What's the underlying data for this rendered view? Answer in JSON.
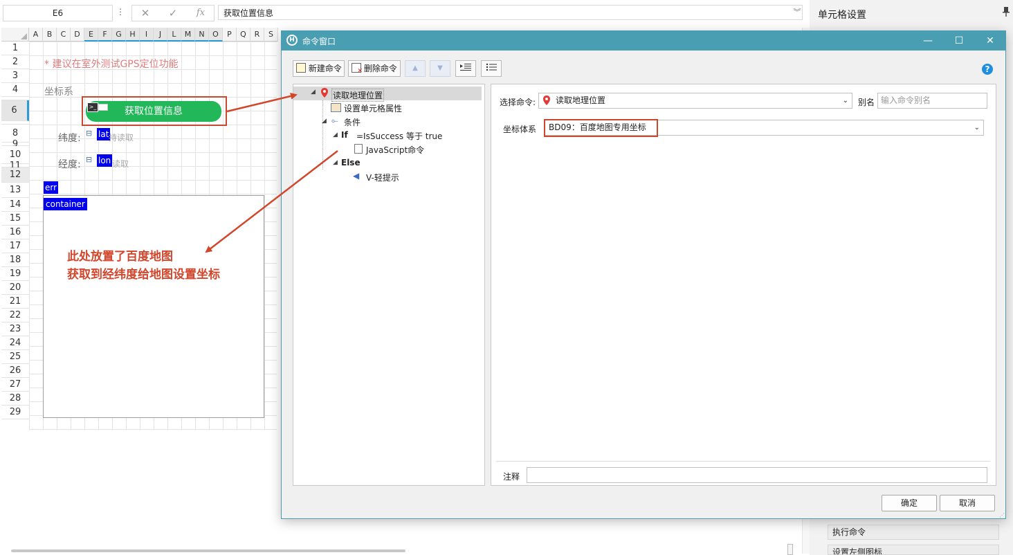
{
  "formula_bar": {
    "name_box": "E6",
    "more_icon": "⋮",
    "cancel_icon": "✕",
    "confirm_icon": "✓",
    "fx_label": "fx",
    "formula_value": "获取位置信息"
  },
  "right_panel": {
    "title": "单元格设置",
    "buttons": [
      "执行命令",
      "设置左侧图标"
    ]
  },
  "sheet": {
    "columns": [
      "A",
      "B",
      "C",
      "D",
      "E",
      "F",
      "G",
      "H",
      "I",
      "J",
      "L",
      "M",
      "N",
      "O",
      "P",
      "Q",
      "R",
      "S"
    ],
    "selected_columns": [
      "E",
      "F",
      "G",
      "H",
      "I",
      "J",
      "L",
      "M",
      "N",
      "O"
    ],
    "rows": [
      "1",
      "2",
      "3",
      "4",
      "",
      "6",
      "",
      "8",
      "9",
      "10",
      "11",
      "12",
      "13",
      "14",
      "15",
      "16",
      "17",
      "18",
      "19",
      "20",
      "21",
      "22",
      "23",
      "24",
      "25",
      "26",
      "27",
      "28",
      "29"
    ],
    "hint_text": "* 建议在室外测试GPS定位功能",
    "coord_label": "坐标系",
    "get_location_button": "获取位置信息",
    "latitude_label": "纬度:",
    "latitude_field": "lat",
    "latitude_tail": "持读取",
    "longitude_label": "经度:",
    "longitude_field": "lon",
    "longitude_tail": "读取",
    "err_label": "err",
    "container_label": "container"
  },
  "annotation": {
    "line1": "此处放置了百度地图",
    "line2": "获取到经纬度给地图设置坐标"
  },
  "dialog": {
    "title": "命令窗口",
    "logo": "H",
    "toolbar": {
      "new_command": "新建命令",
      "delete_command": "删除命令"
    },
    "tree": {
      "root": "读取地理位置",
      "set_cell": "设置单元格属性",
      "condition": "条件",
      "if_keyword": "If",
      "if_condition": "=IsSuccess 等于 true",
      "js_command": "JavaScript命令",
      "else_keyword": "Else",
      "v_prompt": "V-轻提示"
    },
    "props": {
      "select_command_label": "选择命令:",
      "select_command_value": "读取地理位置",
      "alias_label": "别名",
      "alias_placeholder": "输入命令别名",
      "coord_system_label": "坐标体系",
      "coord_system_value": "BD09：百度地图专用坐标",
      "note_label": "注释"
    },
    "ok_button": "确定",
    "cancel_button": "取消"
  },
  "colors": {
    "dialog_titlebar": "#4a9eb1",
    "green_button": "#22b85a",
    "annotation_red": "#d2462c",
    "field_blue": "#0000ee",
    "hint_pink": "#e07c7c"
  }
}
